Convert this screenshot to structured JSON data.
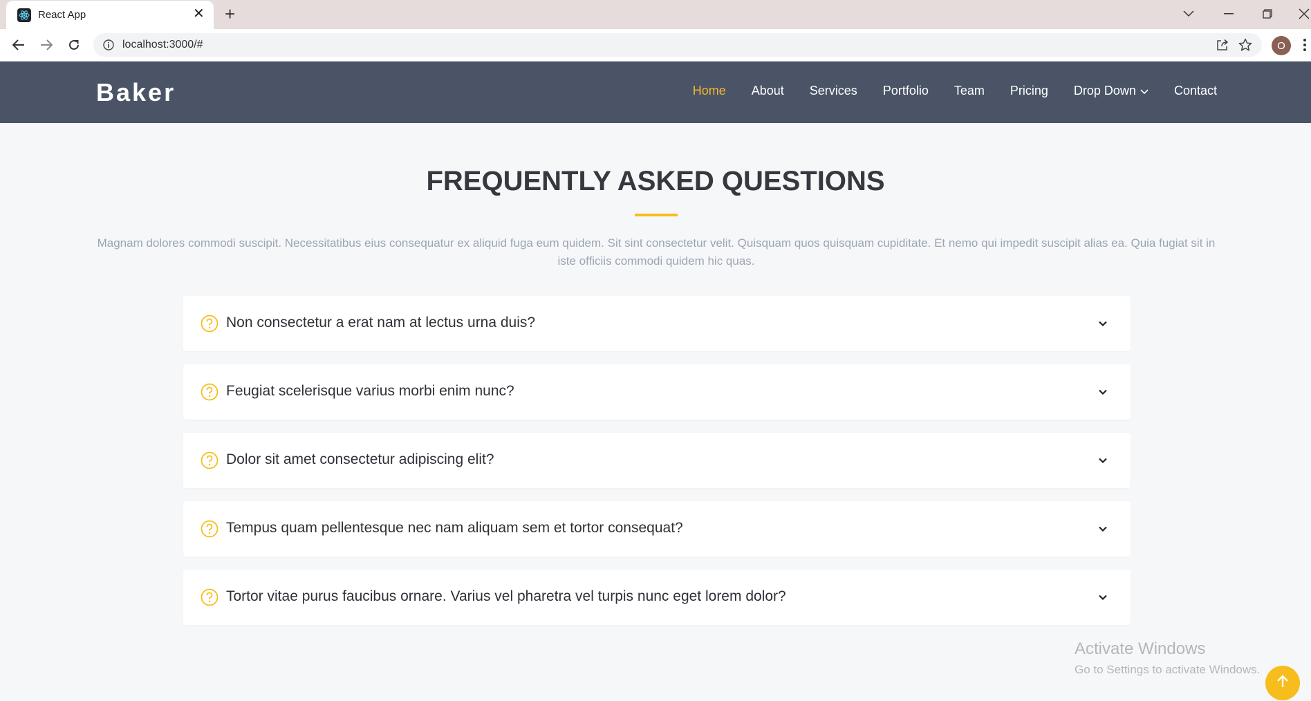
{
  "browser": {
    "tab_title": "React App",
    "url": "localhost:3000/#",
    "profile_initial": "O"
  },
  "header": {
    "logo": "Baker",
    "nav": [
      {
        "label": "Home",
        "active": true
      },
      {
        "label": "About"
      },
      {
        "label": "Services"
      },
      {
        "label": "Portfolio"
      },
      {
        "label": "Team"
      },
      {
        "label": "Pricing"
      },
      {
        "label": "Drop Down"
      },
      {
        "label": "Contact"
      }
    ]
  },
  "faq": {
    "title": "FREQUENTLY ASKED QUESTIONS",
    "intro": "Magnam dolores commodi suscipit. Necessitatibus eius consequatur ex aliquid fuga eum quidem. Sit sint consectetur velit. Quisquam quos quisquam cupiditate. Et nemo qui impedit suscipit alias ea. Quia fugiat sit in iste officiis commodi quidem hic quas.",
    "questions": [
      "Non consectetur a erat nam at lectus urna duis?",
      "Feugiat scelerisque varius morbi enim nunc?",
      "Dolor sit amet consectetur adipiscing elit?",
      "Tempus quam pellentesque nec nam aliquam sem et tortor consequat?",
      "Tortor vitae purus faucibus ornare. Varius vel pharetra vel turpis nunc eget lorem dolor?"
    ]
  },
  "watermark": {
    "title": "Activate Windows",
    "subtitle": "Go to Settings to activate Windows."
  },
  "colors": {
    "accent": "#f7bd1c",
    "header_bg": "#4a5466",
    "page_bg": "#f6f7f8"
  }
}
